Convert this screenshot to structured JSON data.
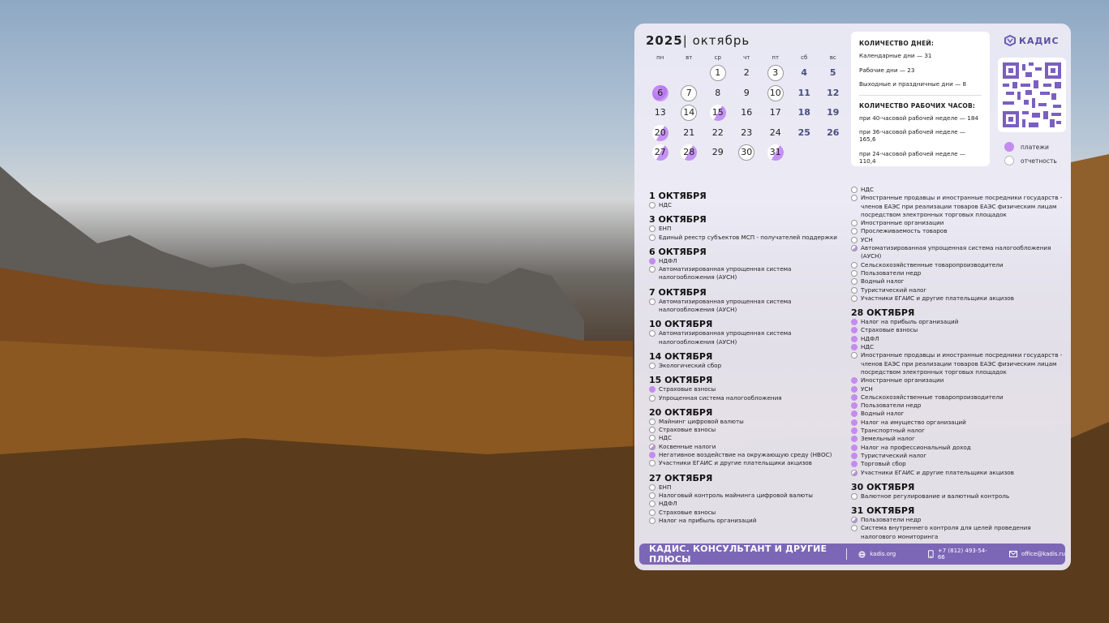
{
  "calendar": {
    "year": "2025",
    "month": "| октябрь",
    "weekdays": [
      "пн",
      "вт",
      "ср",
      "чт",
      "пт",
      "сб",
      "вс"
    ],
    "days": [
      {
        "n": "",
        "t": ""
      },
      {
        "n": "",
        "t": ""
      },
      {
        "n": "1",
        "t": "o"
      },
      {
        "n": "2",
        "t": ""
      },
      {
        "n": "3",
        "t": "o"
      },
      {
        "n": "4",
        "t": "w"
      },
      {
        "n": "5",
        "t": "w"
      },
      {
        "n": "6",
        "t": "p"
      },
      {
        "n": "7",
        "t": "o"
      },
      {
        "n": "8",
        "t": ""
      },
      {
        "n": "9",
        "t": ""
      },
      {
        "n": "10",
        "t": "o"
      },
      {
        "n": "11",
        "t": "w"
      },
      {
        "n": "12",
        "t": "w"
      },
      {
        "n": "13",
        "t": ""
      },
      {
        "n": "14",
        "t": "o"
      },
      {
        "n": "15",
        "t": "half"
      },
      {
        "n": "16",
        "t": ""
      },
      {
        "n": "17",
        "t": ""
      },
      {
        "n": "18",
        "t": "w"
      },
      {
        "n": "19",
        "t": "w"
      },
      {
        "n": "20",
        "t": "half"
      },
      {
        "n": "21",
        "t": ""
      },
      {
        "n": "22",
        "t": ""
      },
      {
        "n": "23",
        "t": ""
      },
      {
        "n": "24",
        "t": ""
      },
      {
        "n": "25",
        "t": "w"
      },
      {
        "n": "26",
        "t": "w"
      },
      {
        "n": "27",
        "t": "half"
      },
      {
        "n": "28",
        "t": "half"
      },
      {
        "n": "29",
        "t": ""
      },
      {
        "n": "30",
        "t": "o"
      },
      {
        "n": "31",
        "t": "half"
      }
    ]
  },
  "info": {
    "days_title": "КОЛИЧЕСТВО ДНЕЙ:",
    "calendar_days": "Календарные дни — 31",
    "work_days": "Рабочие дни — 23",
    "holidays": "Выходные и праздничные дни — 8",
    "hours_title": "КОЛИЧЕСТВО РАБОЧИХ ЧАСОВ:",
    "h40": "при 40-часовой рабочей неделе — 184",
    "h36": "при 36-часовой рабочей неделе — 165,6",
    "h24": "при 24-часовой рабочей неделе — 110,4"
  },
  "logo": "КАДИС",
  "legend": {
    "payments": "платежи",
    "reports": "отчетность"
  },
  "colors": {
    "payment": "#c48bf0",
    "accent": "#7c67b6",
    "weekend": "#4a4e82"
  },
  "events_left": [
    {
      "date": "1 ОКТЯБРЯ",
      "items": [
        [
          "НДС",
          "o"
        ]
      ]
    },
    {
      "date": "3 ОКТЯБРЯ",
      "items": [
        [
          "ЕНП",
          "o"
        ],
        [
          "Единый реестр субъектов МСП - получателей поддержки",
          "o"
        ]
      ]
    },
    {
      "date": "6 ОКТЯБРЯ",
      "items": [
        [
          "НДФЛ",
          "p"
        ],
        [
          "Автоматизированная упрощенная система налогообложения (АУСН)",
          "o"
        ]
      ]
    },
    {
      "date": "7 ОКТЯБРЯ",
      "items": [
        [
          "Автоматизированная упрощенная система налогообложения (АУСН)",
          "o"
        ]
      ]
    },
    {
      "date": "10 ОКТЯБРЯ",
      "items": [
        [
          "Автоматизированная упрощенная система налогообложения (АУСН)",
          "o"
        ]
      ]
    },
    {
      "date": "14 ОКТЯБРЯ",
      "items": [
        [
          "Экологический сбор",
          "o"
        ]
      ]
    },
    {
      "date": "15 ОКТЯБРЯ",
      "items": [
        [
          "Страховые взносы",
          "p"
        ],
        [
          "Упрощенная система налогообложения",
          "o"
        ]
      ]
    },
    {
      "date": "20 ОКТЯБРЯ",
      "items": [
        [
          "Майнинг цифровой валюты",
          "o"
        ],
        [
          "Страховые взносы",
          "o"
        ],
        [
          "НДС",
          "o"
        ],
        [
          "Косвенные налоги",
          "h"
        ],
        [
          "Негативное воздействие на окружающую среду (НВОС)",
          "p"
        ],
        [
          "Участники ЕГАИС и другие плательщики акцизов",
          "o"
        ]
      ]
    },
    {
      "date": "27 ОКТЯБРЯ",
      "items": [
        [
          "ЕНП",
          "o"
        ],
        [
          "Налоговый контроль майнинга цифровой валюты",
          "o"
        ],
        [
          "НДФЛ",
          "o"
        ],
        [
          "Страховые взносы",
          "o"
        ],
        [
          "Налог на прибыль организаций",
          "o"
        ]
      ]
    }
  ],
  "events_right_top": [
    [
      "НДС",
      "o"
    ],
    [
      "Иностранные продавцы и иностранные посредники государств - членов ЕАЭС при реализации товаров ЕАЭС физическим лицам посредством электронных торговых площадок",
      "o"
    ],
    [
      "Иностранные организации",
      "o"
    ],
    [
      "Прослеживаемость товаров",
      "o"
    ],
    [
      "УСН",
      "o"
    ],
    [
      "Автоматизированная упрощенная система налогообложения (АУСН)",
      "h"
    ],
    [
      "Сельскохозяйственные товаропроизводители",
      "o"
    ],
    [
      "Пользователи недр",
      "o"
    ],
    [
      "Водный налог",
      "o"
    ],
    [
      "Туристический налог",
      "o"
    ],
    [
      "Участники ЕГАИС и другие плательщики акцизов",
      "o"
    ]
  ],
  "events_right": [
    {
      "date": "28 ОКТЯБРЯ",
      "items": [
        [
          "Налог на прибыль организаций",
          "p"
        ],
        [
          "Страховые взносы",
          "p"
        ],
        [
          "НДФЛ",
          "p"
        ],
        [
          "НДС",
          "p"
        ],
        [
          "Иностранные продавцы и иностранные посредники государств - членов ЕАЭС при реализации товаров ЕАЭС физическим лицам посредством электронных торговых площадок",
          "o"
        ],
        [
          "Иностранные организации",
          "p"
        ],
        [
          "УСН",
          "p"
        ],
        [
          "Сельскохозяйственные товаропроизводители",
          "p"
        ],
        [
          "Пользователи недр",
          "p"
        ],
        [
          "Водный налог",
          "p"
        ],
        [
          "Налог на имущество организаций",
          "p"
        ],
        [
          "Транспортный налог",
          "p"
        ],
        [
          "Земельный налог",
          "p"
        ],
        [
          "Налог на профессиональный доход",
          "p"
        ],
        [
          "Туристический налог",
          "p"
        ],
        [
          "Торговый сбор",
          "p"
        ],
        [
          "Участники ЕГАИС и другие плательщики акцизов",
          "h"
        ]
      ]
    },
    {
      "date": "30 ОКТЯБРЯ",
      "items": [
        [
          "Валютное регулирование и валютный контроль",
          "o"
        ]
      ]
    },
    {
      "date": "31 ОКТЯБРЯ",
      "items": [
        [
          "Пользователи недр",
          "h"
        ],
        [
          "Система внутреннего контроля для целей проведения налогового мониторинга",
          "o"
        ]
      ]
    }
  ],
  "footer": {
    "brand": "КАДИС. КОНСУЛЬТАНТ И ДРУГИЕ ПЛЮСЫ",
    "site": "kadis.org",
    "phone": "+7 (812) 493-54-66",
    "email": "office@kadis.ru"
  }
}
